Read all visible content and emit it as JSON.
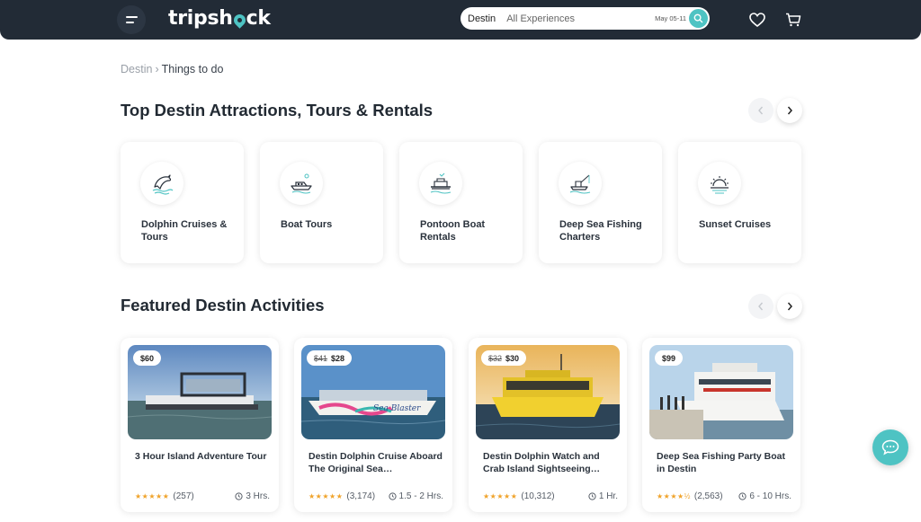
{
  "header": {
    "logo_text_1": "tripsh",
    "logo_text_2": "ck",
    "search": {
      "location": "Destin",
      "experience": "All Experiences",
      "date": "May 05-11"
    }
  },
  "breadcrumb": {
    "parent": "Destin",
    "separator": "›",
    "current": "Things to do"
  },
  "attractions": {
    "title": "Top Destin Attractions, Tours & Rentals",
    "items": [
      {
        "label": "Dolphin Cruises & Tours",
        "icon": "dolphin-icon"
      },
      {
        "label": "Boat Tours",
        "icon": "boat-icon"
      },
      {
        "label": "Pontoon Boat Rentals",
        "icon": "pontoon-icon"
      },
      {
        "label": "Deep Sea Fishing Charters",
        "icon": "fishing-boat-icon"
      },
      {
        "label": "Sunset Cruises",
        "icon": "sunset-icon"
      }
    ]
  },
  "featured": {
    "title": "Featured Destin Activities",
    "items": [
      {
        "price": "$60",
        "old_price": "",
        "title": "3 Hour Island Adventure Tour",
        "stars": "★★★★★",
        "reviews": "(257)",
        "duration": "3 Hrs."
      },
      {
        "price": "$28",
        "old_price": "$41",
        "title": "Destin Dolphin Cruise Aboard The Original Sea…",
        "stars": "★★★★★",
        "reviews": "(3,174)",
        "duration": "1.5 - 2 Hrs."
      },
      {
        "price": "$30",
        "old_price": "$32",
        "title": "Destin Dolphin Watch and Crab Island Sightseeing…",
        "stars": "★★★★★",
        "reviews": "(10,312)",
        "duration": "1 Hr."
      },
      {
        "price": "$99",
        "old_price": "",
        "title": "Deep Sea Fishing Party Boat in Destin",
        "stars": "★★★★½",
        "reviews": "(2,563)",
        "duration": "6 - 10 Hrs."
      }
    ]
  },
  "colors": {
    "header_bg": "#222b36",
    "accent": "#4ec3c3",
    "star": "#f0a32a"
  }
}
